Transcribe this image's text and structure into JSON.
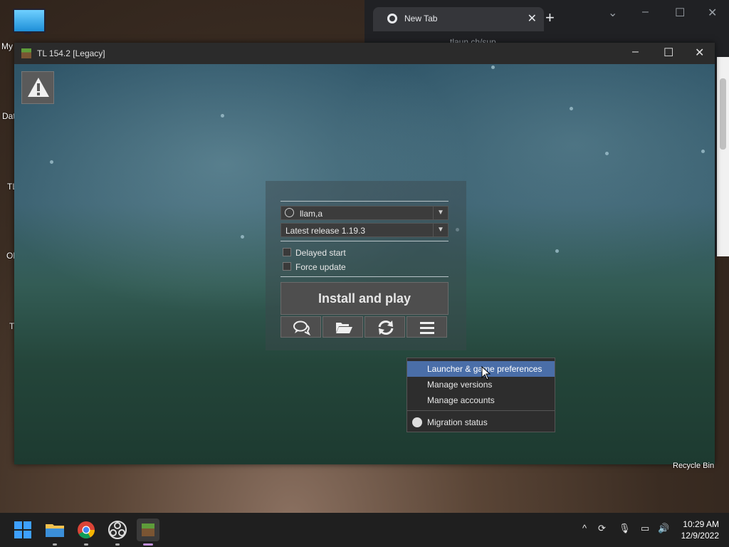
{
  "desktop": {
    "icons": [
      {
        "label": "My"
      },
      {
        "label": "Dat"
      },
      {
        "label": "TL"
      },
      {
        "label": "Ol"
      },
      {
        "label": "T"
      }
    ],
    "recycle_bin": "Recycle Bin"
  },
  "chrome": {
    "tab_title": "New Tab",
    "address": "tlaun.ch/sup"
  },
  "launcher": {
    "title": "TL 154.2 [Legacy]",
    "account": "llam,a",
    "version": "Latest release 1.19.3",
    "delayed_start": "Delayed start",
    "force_update": "Force update",
    "play_button": "Install and play",
    "menu": {
      "items": [
        {
          "label": "Launcher & game preferences"
        },
        {
          "label": "Manage versions"
        },
        {
          "label": "Manage accounts"
        },
        {
          "label": "Migration status"
        }
      ]
    }
  },
  "taskbar": {
    "time": "10:29 AM",
    "date": "12/9/2022"
  },
  "colors": {
    "menu_highlight": "#4a6ea8",
    "taskbar": "#1f1f1f"
  }
}
